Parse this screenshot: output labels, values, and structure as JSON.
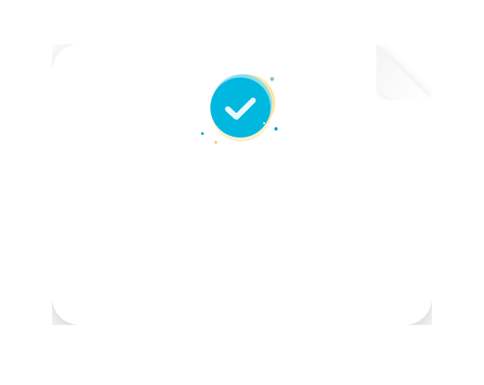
{
  "dialog": {
    "icon": "success-check-icon",
    "colors": {
      "card": "#ffffff",
      "badge_primary": "#00b8df",
      "badge_halo": "#7fdcf1",
      "badge_accent": "#f7d77a",
      "check": "#e8f8fd",
      "dot_green": "#8cc98a",
      "dot_blue": "#0aa8c9",
      "dot_yellow": "#f5c96b"
    }
  }
}
